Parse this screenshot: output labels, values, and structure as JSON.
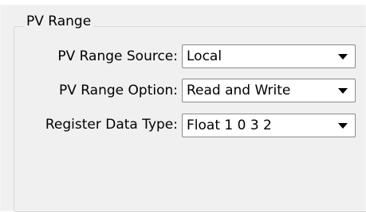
{
  "group": {
    "title": "PV Range"
  },
  "fields": [
    {
      "label": "PV Range Source:",
      "value": "Local"
    },
    {
      "label": "PV Range Option:",
      "value": "Read and Write"
    },
    {
      "label": "Register Data Type:",
      "value": "Float 1 0 3 2"
    }
  ],
  "icons": {
    "dropdown": "chevron-down-icon"
  }
}
